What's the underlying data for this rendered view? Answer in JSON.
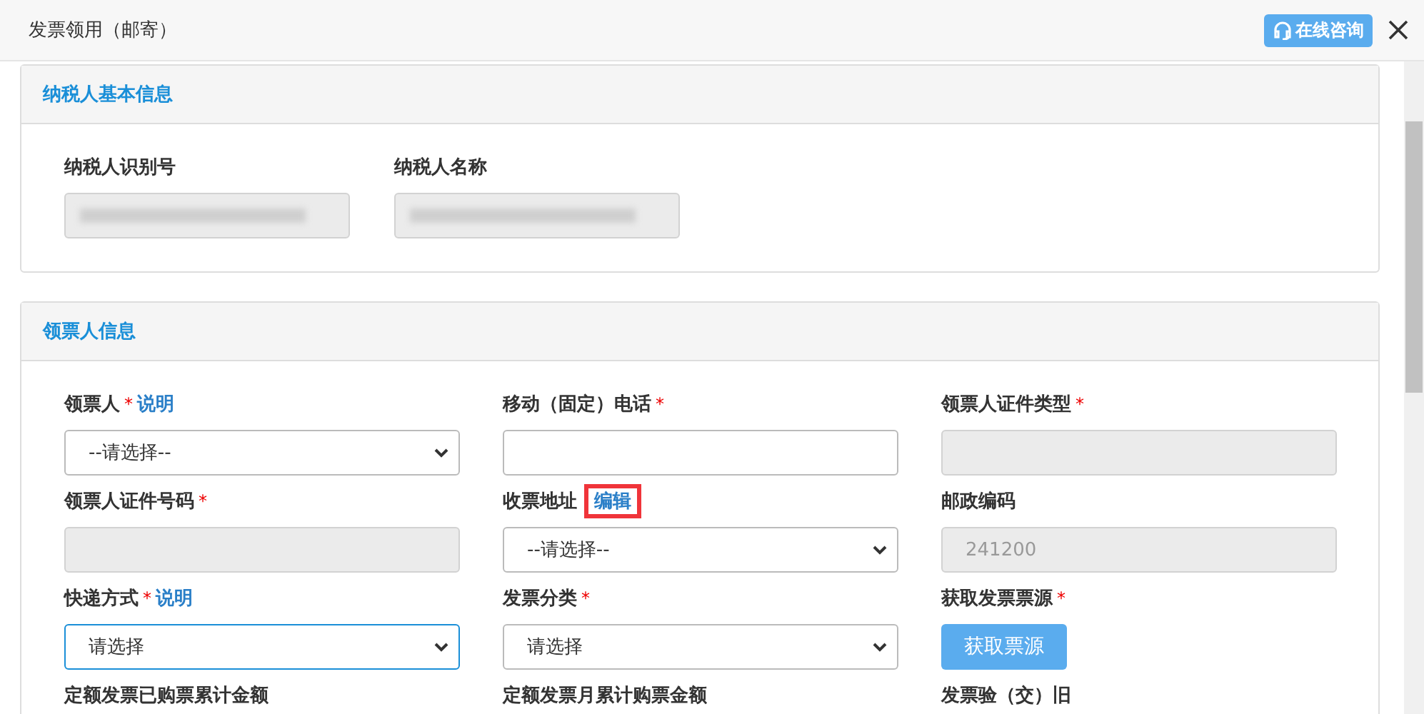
{
  "window": {
    "title": "发票领用（邮寄）",
    "consult_button": "在线咨询"
  },
  "sections": [
    {
      "title": "纳税人基本信息",
      "kind": "basic",
      "fields": [
        {
          "label": "纳税人识别号",
          "control": {
            "kind": "input",
            "disabled": true,
            "redacted": true
          }
        },
        {
          "label": "纳税人名称",
          "control": {
            "kind": "input",
            "disabled": true,
            "redacted": true
          }
        }
      ]
    },
    {
      "title": "领票人信息",
      "kind": "details",
      "fields": [
        {
          "label": "领票人",
          "marker": "*",
          "link": "说明",
          "control": {
            "kind": "select",
            "value": "--请选择--",
            "disabled": false,
            "focused": false
          }
        },
        {
          "label": "移动（固定）电话",
          "marker": "*",
          "control": {
            "kind": "input"
          }
        },
        {
          "label": "领票人证件类型",
          "marker": "*",
          "control": {
            "kind": "input",
            "disabled": true
          }
        },
        {
          "label": "领票人证件号码",
          "marker": "*",
          "control": {
            "kind": "input",
            "disabled": true
          }
        },
        {
          "label": "收票地址",
          "highlight_link": "编辑",
          "control": {
            "kind": "select",
            "value": "--请选择--",
            "disabled": false,
            "focused": false
          }
        },
        {
          "label": "邮政编码",
          "control": {
            "kind": "input",
            "value": "241200",
            "disabled": true
          }
        },
        {
          "label": "快递方式",
          "marker": "*",
          "link": "说明",
          "control": {
            "kind": "select",
            "value": "请选择",
            "disabled": false,
            "focused": true
          }
        },
        {
          "label": "发票分类",
          "marker": "*",
          "control": {
            "kind": "select",
            "value": "请选择",
            "disabled": false,
            "focused": false
          }
        },
        {
          "label": "获取发票票源",
          "marker": "*",
          "control": {
            "kind": "button",
            "text": "获取票源"
          }
        },
        {
          "label": "定额发票已购票累计金额"
        },
        {
          "label": "定额发票月累计购票金额"
        },
        {
          "label": "发票验（交）旧"
        }
      ]
    }
  ]
}
